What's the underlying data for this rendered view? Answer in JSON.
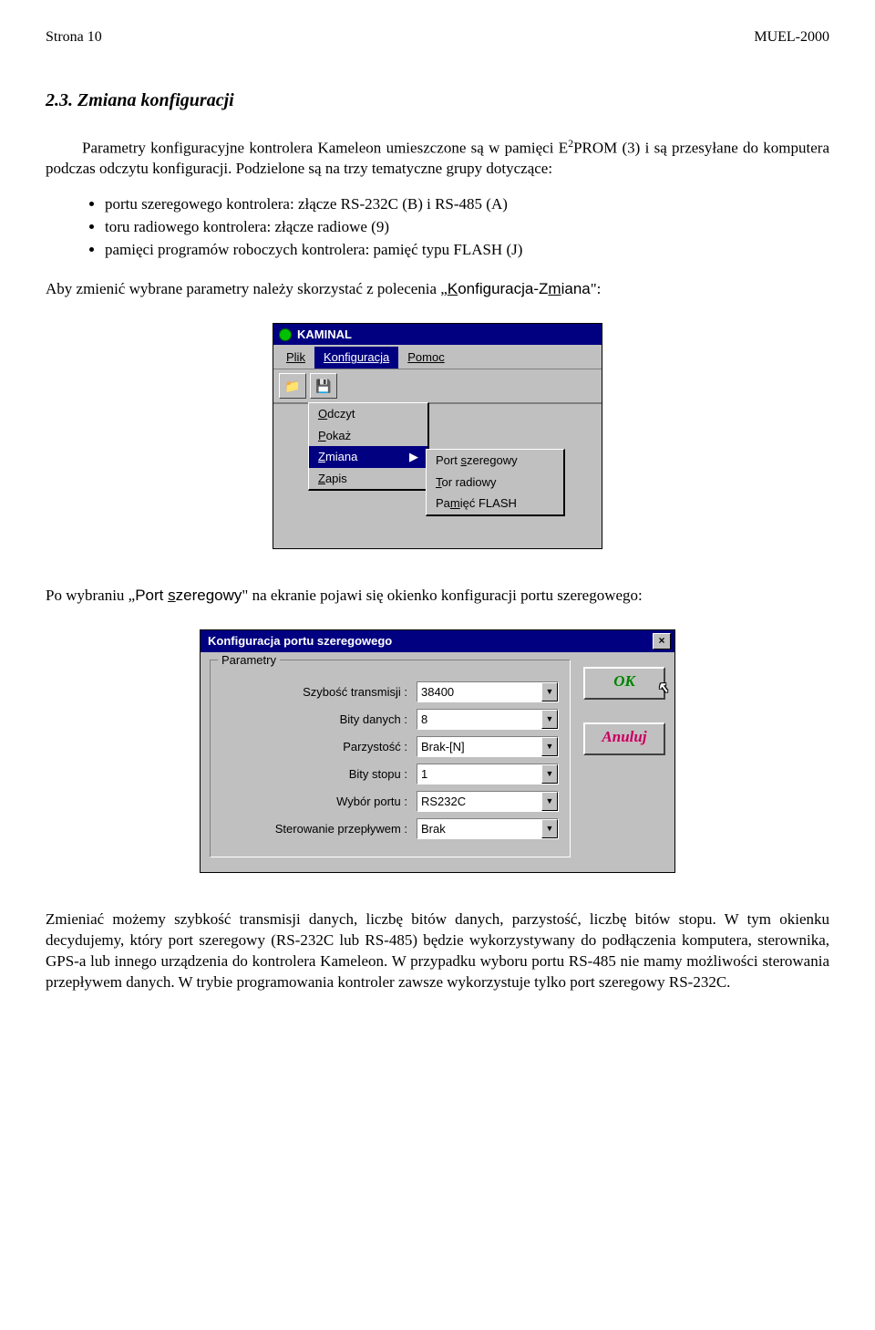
{
  "header": {
    "left": "Strona 10",
    "right": "MUEL-2000"
  },
  "section_heading": "2.3. Zmiana konfiguracji",
  "para1_a": "Parametry konfiguracyjne kontrolera Kameleon umieszczone są w pamięci E",
  "para1_sup": "2",
  "para1_b": "PROM (3) i są przesyłane do komputera podczas odczytu konfiguracji. Podzielone są na trzy tematyczne grupy dotyczące:",
  "bullets": [
    "portu szeregowego kontrolera: złącze RS-232C (B) i RS-485 (A)",
    "toru radiowego kontrolera: złącze radiowe (9)",
    "pamięci programów roboczych kontrolera: pamięć typu FLASH (J)"
  ],
  "para2_a": "Aby zmienić wybrane parametry należy skorzystać z polecenia „",
  "para2_link1_u": "K",
  "para2_link1_rest": "onfiguracja-Z",
  "para2_link1_u2": "m",
  "para2_link1_rest2": "iana",
  "para2_b": "\":",
  "menu": {
    "app_title": "KAMINAL",
    "menubar": [
      "Plik",
      "Konfiguracja",
      "Pomoc"
    ],
    "selected_idx": 1,
    "popup": [
      {
        "u": "O",
        "rest": "dczyt"
      },
      {
        "u": "P",
        "rest": "okaż"
      },
      {
        "u": "Z",
        "rest": "miana",
        "selected": true
      },
      {
        "u": "Z",
        "rest": "apis"
      }
    ],
    "submenu": [
      {
        "pre": "Port ",
        "u": "s",
        "rest": "zeregowy"
      },
      {
        "u": "T",
        "rest": "or radiowy"
      },
      {
        "pre": "Pa",
        "u": "m",
        "rest": "ięć FLASH"
      }
    ]
  },
  "para3_a": "Po wybraniu „",
  "para3_link_pre": "Port ",
  "para3_link_u": "s",
  "para3_link_rest": "zeregowy",
  "para3_b": "\" na ekranie pojawi się okienko konfiguracji portu szeregowego:",
  "dialog": {
    "title": "Konfiguracja portu szeregowego",
    "group": "Parametry",
    "rows": [
      {
        "label": "Szybość transmisji :",
        "value": "38400"
      },
      {
        "label": "Bity danych :",
        "value": "8"
      },
      {
        "label": "Parzystość :",
        "value": "Brak-[N]"
      },
      {
        "label": "Bity stopu :",
        "value": "1"
      },
      {
        "label": "Wybór portu :",
        "value": "RS232C"
      },
      {
        "label": "Sterowanie przepływem :",
        "value": "Brak"
      }
    ],
    "ok": "OK",
    "cancel": "Anuluj"
  },
  "para4": "Zmieniać możemy szybkość transmisji danych, liczbę bitów danych, parzystość, liczbę bitów stopu. W tym okienku decydujemy, który port szeregowy (RS-232C lub RS-485) będzie wykorzystywany do podłączenia komputera, sterownika, GPS-a lub innego urządzenia do kontrolera Kameleon. W przypadku wyboru portu RS-485 nie mamy możliwości sterowania przepływem danych. W trybie programowania kontroler zawsze wykorzystuje tylko port szeregowy RS-232C."
}
